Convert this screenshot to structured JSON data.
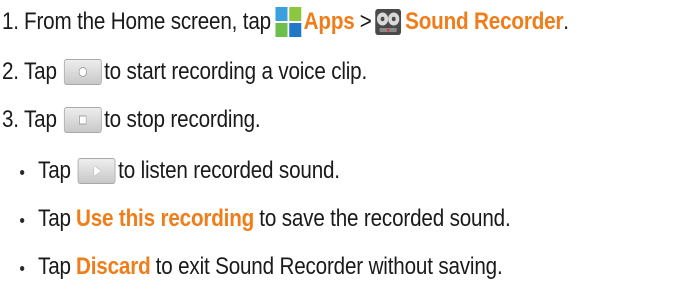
{
  "steps": [
    {
      "number": "1.",
      "before": "From the Home screen, tap",
      "apps_label": "Apps",
      "separator": ">",
      "recorder_label": "Sound Recorder",
      "end": "."
    },
    {
      "number": "2.",
      "before": "Tap",
      "after": "to start recording a voice clip."
    },
    {
      "number": "3.",
      "before": "Tap",
      "after": "to stop recording."
    }
  ],
  "bullets": [
    {
      "before": "Tap",
      "after": "to listen recorded sound."
    },
    {
      "before": "Tap",
      "highlight": "Use this recording",
      "after": "to save the recorded sound."
    },
    {
      "before": "Tap",
      "highlight": "Discard",
      "after": "to exit Sound Recorder without saving."
    }
  ],
  "icons": {
    "apps": "apps-grid-icon",
    "recorder": "sound-recorder-icon",
    "record_button": "record-icon",
    "stop_button": "stop-icon",
    "play_button": "play-icon"
  },
  "colors": {
    "highlight": "#ef7d1a",
    "text": "#1a1a1a"
  }
}
